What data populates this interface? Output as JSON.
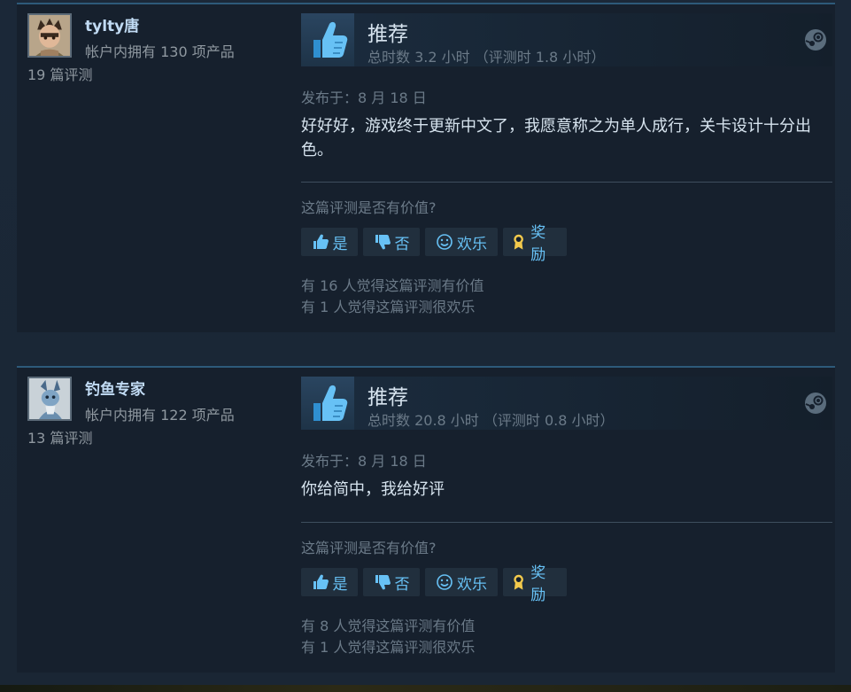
{
  "reviews": [
    {
      "persona": "tylty唐",
      "owned": "帐户内拥有 130 项产品",
      "num_reviews": "19 篇评测",
      "vote_title": "推荐",
      "hours": "总时数 3.2 小时 （评测时 1.8 小时）",
      "posted": "发布于：8 月 18 日",
      "content": "好好好，游戏终于更新中文了，我愿意称之为单人成行，关卡设计十分出色。",
      "helpful_question": "这篇评测是否有价值?",
      "btn_yes": "是",
      "btn_no": "否",
      "btn_funny": "欢乐",
      "btn_award": "奖励",
      "helpful_stat": "有 16 人觉得这篇评测有价值",
      "funny_stat": "有 1 人觉得这篇评测很欢乐"
    },
    {
      "persona": "钓鱼专家",
      "owned": "帐户内拥有 122 项产品",
      "num_reviews": "13 篇评测",
      "vote_title": "推荐",
      "hours": "总时数 20.8 小时 （评测时 0.8 小时）",
      "posted": "发布于：8 月 18 日",
      "content": "你给简中，我给好评",
      "helpful_question": "这篇评测是否有价值?",
      "btn_yes": "是",
      "btn_no": "否",
      "btn_funny": "欢乐",
      "btn_award": "奖励",
      "helpful_stat": "有 8 人觉得这篇评测有价值",
      "funny_stat": "有 1 人觉得这篇评测很欢乐"
    }
  ],
  "icons": {
    "thumb": "thumbs-up-icon",
    "steam": "steam-logo-icon",
    "yes": "thumbs-up-icon",
    "no": "thumbs-down-icon",
    "funny": "smiley-icon",
    "award": "award-ribbon-icon"
  },
  "colors": {
    "accent_blue": "#67c1f5",
    "background": "#1b2838",
    "card": "#16202d",
    "award_gold": "#f2c94c"
  }
}
